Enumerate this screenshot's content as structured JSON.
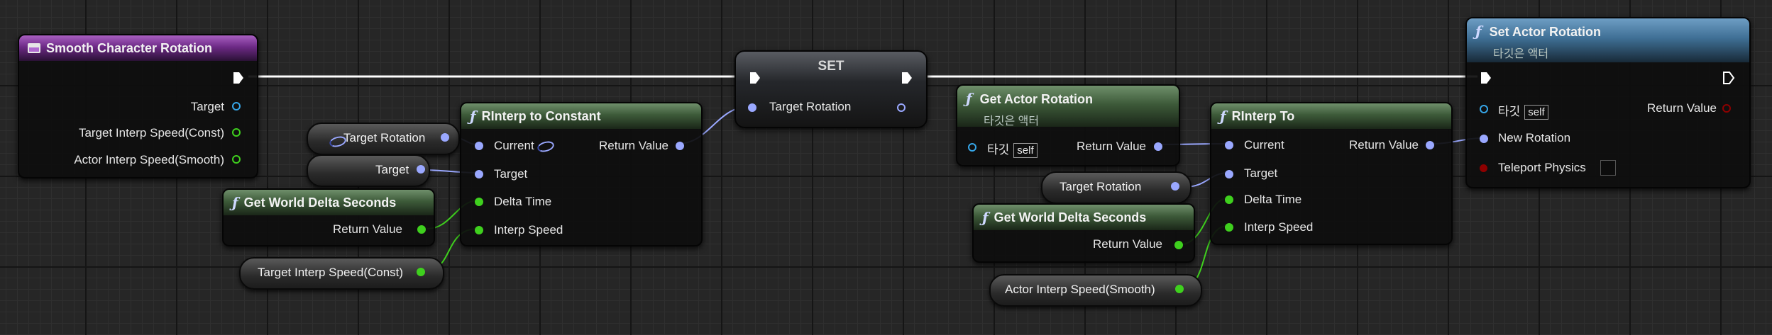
{
  "event_node": {
    "title": "Smooth Character Rotation",
    "pins": [
      "Target",
      "Target Interp Speed(Const)",
      "Actor Interp Speed(Smooth)"
    ]
  },
  "var_target_rotation_left": "Target Rotation",
  "var_target_left": "Target",
  "get_delta_1": {
    "title": "Get World Delta Seconds",
    "return": "Return Value"
  },
  "var_target_interp_const": "Target Interp Speed(Const)",
  "rinterp_const": {
    "title": "RInterp to Constant",
    "inputs": [
      "Current",
      "Target",
      "Delta Time",
      "Interp Speed"
    ],
    "return": "Return Value"
  },
  "set_node": {
    "title": "SET",
    "pin": "Target Rotation"
  },
  "get_actor_rotation": {
    "title": "Get Actor Rotation",
    "subtitle": "타깃은 액터",
    "target": "타깃",
    "self": "self",
    "return": "Return Value"
  },
  "var_target_rotation_right": "Target Rotation",
  "get_delta_2": {
    "title": "Get World Delta Seconds",
    "return": "Return Value"
  },
  "var_actor_interp_smooth": "Actor Interp Speed(Smooth)",
  "rinterp_to": {
    "title": "RInterp To",
    "inputs": [
      "Current",
      "Target",
      "Delta Time",
      "Interp Speed"
    ],
    "return": "Return Value"
  },
  "set_actor_rotation": {
    "title": "Set Actor Rotation",
    "subtitle": "타깃은 액터",
    "target": "타깃",
    "self": "self",
    "return": "Return Value",
    "new_rotation": "New Rotation",
    "teleport": "Teleport Physics"
  },
  "colors": {
    "rotator_pin": "#9aa8ff",
    "float_pin": "#3fd01e",
    "object_pin": "#36a6e8",
    "bool_pin": "#8e0000",
    "exec_wire": "#ffffff"
  }
}
